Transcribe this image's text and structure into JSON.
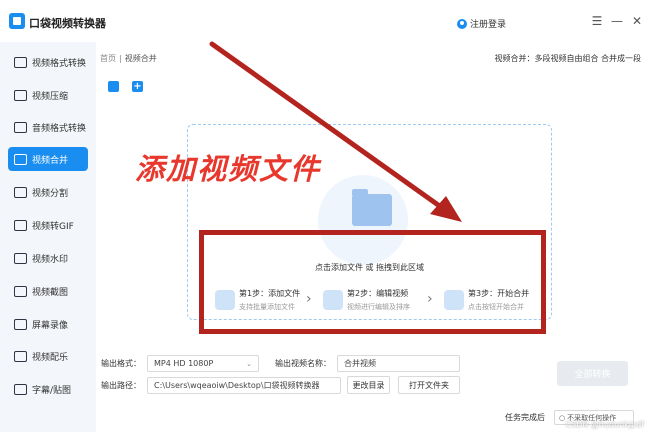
{
  "app": {
    "title": "口袋视频转换器",
    "login": "注册登录",
    "menu_glyph": "☰",
    "minimize_glyph": "—",
    "close_glyph": "✕"
  },
  "sidebar": {
    "items": [
      {
        "label": "视频格式转换",
        "icon": "video-convert-icon",
        "active": false
      },
      {
        "label": "视频压缩",
        "icon": "compress-icon",
        "active": false
      },
      {
        "label": "音频格式转换",
        "icon": "audio-convert-icon",
        "active": false
      },
      {
        "label": "视频合并",
        "icon": "merge-icon",
        "active": true
      },
      {
        "label": "视频分割",
        "icon": "split-icon",
        "active": false
      },
      {
        "label": "视频转GIF",
        "icon": "gif-icon",
        "active": false
      },
      {
        "label": "视频水印",
        "icon": "watermark-icon",
        "active": false
      },
      {
        "label": "视频截图",
        "icon": "screenshot-icon",
        "active": false
      },
      {
        "label": "屏幕录像",
        "icon": "record-icon",
        "active": false
      },
      {
        "label": "视频配乐",
        "icon": "music-icon",
        "active": false
      },
      {
        "label": "字幕/贴图",
        "icon": "subtitle-icon",
        "active": false
      }
    ]
  },
  "breadcrumb": {
    "home": "首页",
    "separator": "|",
    "current": "视频合并"
  },
  "top_desc": "视频合并：多段视频自由组合 合并成一段",
  "drop": {
    "hint": "点击添加文件 或 拖拽到此区域",
    "steps": [
      {
        "title": "第1步：添加文件",
        "desc": "支持批量添加文件"
      },
      {
        "title": "第2步：编辑视频",
        "desc": "视频进行编辑及排序"
      },
      {
        "title": "第3步：开始合并",
        "desc": "点击按钮开始合并"
      }
    ],
    "arrow_glyph": "›"
  },
  "annotation": {
    "text": "添加视频文件",
    "color": "#e8372c",
    "box_color": "#b3241f"
  },
  "form": {
    "format_label": "输出格式：",
    "format_value": "MP4  HD 1080P",
    "select_glyph": "⌄",
    "name_label": "输出视频名称：",
    "name_value": "合并视频",
    "path_label": "输出路径：",
    "path_value": "C:\\Users\\wqeaoiw\\Desktop\\口袋视频转换器",
    "change_dir": "更改目录",
    "open_folder": "打开文件夹",
    "convert_all": "全部转换"
  },
  "bottom": {
    "after_label": "任务完成后",
    "after_value": "不采取任何操作",
    "radio_glyph": "○",
    "watermark": "CSDN @hudunkjpdf"
  }
}
